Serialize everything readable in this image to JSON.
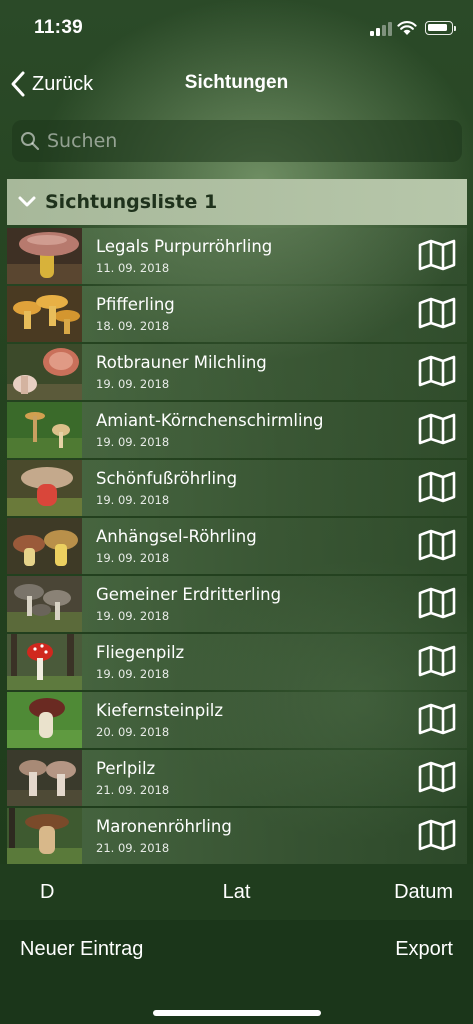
{
  "status_bar": {
    "time": "11:39"
  },
  "nav": {
    "back_label": "Zurück",
    "title": "Sichtungen"
  },
  "search": {
    "placeholder": "Suchen",
    "value": ""
  },
  "section": {
    "title": "Sichtungsliste 1"
  },
  "sightings": [
    {
      "name": "Legals Purpurröhrling",
      "date": "11. 09. 2018",
      "icon": "map-icon"
    },
    {
      "name": "Pfifferling",
      "date": "18. 09. 2018",
      "icon": "map-icon"
    },
    {
      "name": "Rotbrauner Milchling",
      "date": "19. 09. 2018",
      "icon": "map-icon"
    },
    {
      "name": "Amiant-Körnchenschirmling",
      "date": "19. 09. 2018",
      "icon": "map-icon"
    },
    {
      "name": "Schönfußröhrling",
      "date": "19. 09. 2018",
      "icon": "map-icon"
    },
    {
      "name": "Anhängsel-Röhrling",
      "date": "19. 09. 2018",
      "icon": "map-icon"
    },
    {
      "name": "Gemeiner Erdritterling",
      "date": "19. 09. 2018",
      "icon": "map-icon"
    },
    {
      "name": "Fliegenpilz",
      "date": "19. 09. 2018",
      "icon": "map-icon"
    },
    {
      "name": "Kiefernsteinpilz",
      "date": "20. 09. 2018",
      "icon": "map-icon"
    },
    {
      "name": "Perlpilz",
      "date": "21. 09. 2018",
      "icon": "map-icon"
    },
    {
      "name": "Maronenröhrling",
      "date": "21. 09. 2018",
      "icon": "map-icon"
    }
  ],
  "sort_bar": {
    "d_label": "D",
    "lat_label": "Lat",
    "datum_label": "Datum"
  },
  "toolbar": {
    "new_entry_label": "Neuer Eintrag",
    "export_label": "Export"
  },
  "colors": {
    "accent": "#ffffff",
    "section_bg": "#b2c2a5",
    "background": "#24421f"
  }
}
